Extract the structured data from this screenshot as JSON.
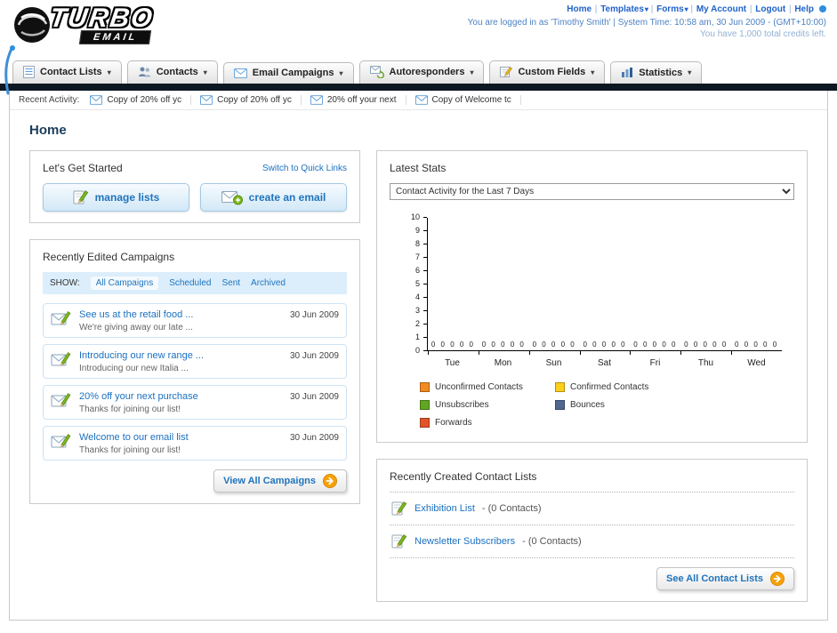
{
  "header": {
    "logo": {
      "line1": "TURBO",
      "line2": "EMAIL"
    },
    "nav_links": [
      {
        "label": "Home",
        "dropdown": false
      },
      {
        "label": "Templates",
        "dropdown": true
      },
      {
        "label": "Forms",
        "dropdown": true
      },
      {
        "label": "My Account",
        "dropdown": false
      },
      {
        "label": "Logout",
        "dropdown": false
      },
      {
        "label": "Help",
        "dropdown": false
      }
    ],
    "login_info": "You are logged in as 'Timothy Smith' | System Time: 10:58 am, 30 Jun 2009 - (GMT+10:00)",
    "credits_info": "You have 1,000 total credits left."
  },
  "nav_tabs": [
    {
      "label": "Contact Lists",
      "icon": "contact-lists-icon"
    },
    {
      "label": "Contacts",
      "icon": "contacts-icon"
    },
    {
      "label": "Email Campaigns",
      "icon": "email-campaigns-icon"
    },
    {
      "label": "Autoresponders",
      "icon": "autoresponders-icon"
    },
    {
      "label": "Custom Fields",
      "icon": "custom-fields-icon"
    },
    {
      "label": "Statistics",
      "icon": "statistics-icon"
    }
  ],
  "recent_activity": {
    "label": "Recent Activity:",
    "items": [
      {
        "text": "Copy of 20% off yc"
      },
      {
        "text": "Copy of 20% off yc"
      },
      {
        "text": "20% off your next"
      },
      {
        "text": "Copy of Welcome tc"
      }
    ]
  },
  "page_title": "Home",
  "get_started": {
    "title": "Let's Get Started",
    "switch_link": "Switch to Quick Links",
    "buttons": [
      {
        "label": "manage lists",
        "icon": "pencil-icon"
      },
      {
        "label": "create an email",
        "icon": "create-email-icon"
      }
    ]
  },
  "campaigns": {
    "title": "Recently Edited Campaigns",
    "show_label": "SHOW:",
    "filters": [
      {
        "label": "All Campaigns",
        "active": true
      },
      {
        "label": "Scheduled",
        "active": false
      },
      {
        "label": "Sent",
        "active": false
      },
      {
        "label": "Archived",
        "active": false
      }
    ],
    "items": [
      {
        "title": "See us at the retail food ...",
        "subtitle": "We're giving away our late ...",
        "date": "30 Jun 2009"
      },
      {
        "title": "Introducing our new range ...",
        "subtitle": "Introducing our new Italia ...",
        "date": "30 Jun 2009"
      },
      {
        "title": "20% off your next purchase",
        "subtitle": "Thanks for joining our list!",
        "date": "30 Jun 2009"
      },
      {
        "title": "Welcome to our email list",
        "subtitle": "Thanks for joining our list!",
        "date": "30 Jun 2009"
      }
    ],
    "view_all_label": "View All Campaigns"
  },
  "stats": {
    "title": "Latest Stats",
    "dropdown_value": "Contact Activity for the Last 7 Days",
    "chart_data": {
      "type": "bar",
      "categories": [
        "Tue",
        "Mon",
        "Sun",
        "Sat",
        "Fri",
        "Thu",
        "Wed"
      ],
      "series": [
        {
          "name": "Unconfirmed Contacts",
          "color": "#f28a1f",
          "values": [
            0,
            0,
            0,
            0,
            0,
            0,
            0
          ]
        },
        {
          "name": "Confirmed Contacts",
          "color": "#fdd017",
          "values": [
            0,
            0,
            0,
            0,
            0,
            0,
            0
          ]
        },
        {
          "name": "Unsubscribes",
          "color": "#61a620",
          "values": [
            0,
            0,
            0,
            0,
            0,
            0,
            0
          ]
        },
        {
          "name": "Bounces",
          "color": "#50688f",
          "values": [
            0,
            0,
            0,
            0,
            0,
            0,
            0
          ]
        },
        {
          "name": "Forwards",
          "color": "#e2552b",
          "values": [
            0,
            0,
            0,
            0,
            0,
            0,
            0
          ]
        }
      ],
      "ylim": [
        0,
        10
      ],
      "ytick_step": 1,
      "grid": false,
      "legend_position": "bottom"
    }
  },
  "contact_lists": {
    "title": "Recently Created Contact Lists",
    "items": [
      {
        "name": "Exhibition List",
        "suffix": "- (0 Contacts)"
      },
      {
        "name": "Newsletter Subscribers",
        "suffix": "- (0 Contacts)"
      }
    ],
    "see_all_label": "See All Contact Lists"
  }
}
